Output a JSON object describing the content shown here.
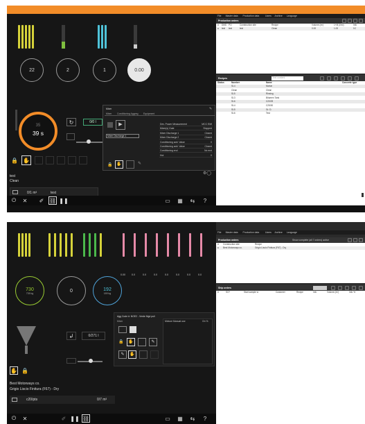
{
  "accent": "#f28c28",
  "top": {
    "menu": [
      "File",
      "Master data",
      "Production data",
      "Users",
      "Archive",
      "Language"
    ],
    "production_orders": {
      "title": "Production orders",
      "columns": [
        "#",
        "DMD",
        "PO",
        "Construction site",
        "Recipe",
        "Volume (m³)",
        "1+M (l/m³)",
        "Info"
      ],
      "row": [
        "",
        "test",
        "test",
        "test",
        "Clean",
        "0.00",
        "1.00",
        "0.0"
      ]
    },
    "mixer": {
      "big_value": "39 s",
      "big_small": "35",
      "circles": [
        "22",
        "2",
        "1",
        "0.00"
      ],
      "counter": "0/0 l",
      "order_name": "test",
      "order_recipe": "Clean",
      "volume": "0/1 m³",
      "volume_name": "test"
    },
    "mixer_dialog": {
      "title": "Mixer",
      "tabs": [
        "Mixer",
        "Conditioning Aggreg",
        "Equipment"
      ],
      "select": "Mixer Discharge 1",
      "rows": [
        {
          "k": "Dev. Power Measurement",
          "v": "MCC EMI"
        },
        {
          "k": "Mixer(s) Gate",
          "v": "Stopped"
        },
        {
          "k": "Mixer Discharge 1",
          "v": "Closed"
        },
        {
          "k": "Mixer Discharge 2",
          "v": "Closed"
        },
        {
          "k": "Conditioning add. Value",
          "v": "0"
        },
        {
          "k": "Conditioning add. Value",
          "v": "Closed"
        },
        {
          "k": "Conditioning end",
          "v": "No end"
        },
        {
          "k": "Hot",
          "v": "0"
        }
      ]
    },
    "recipes": {
      "title": "Recipes",
      "search_placeholder": "Text content",
      "columns": [
        "Status",
        "Number",
        "Name",
        "Concrete type"
      ],
      "rows": [
        {
          "n": "SL4",
          "name": "Mortar"
        },
        {
          "n": "Clean",
          "name": "Clean"
        },
        {
          "n": "SL5",
          "name": "Rinsing"
        },
        {
          "n": "SL3",
          "name": "Bitumen Tank"
        },
        {
          "n": "SL6",
          "name": "C20/25"
        },
        {
          "n": "SL4",
          "name": "C25/30"
        },
        {
          "n": "SL5",
          "name": "Gr. D."
        },
        {
          "n": "SL6",
          "name": "Test"
        }
      ]
    }
  },
  "bottom": {
    "menu": [
      "File",
      "Master data",
      "Production data",
      "Users",
      "Archive",
      "Language"
    ],
    "production_orders": {
      "title": "Production orders",
      "filter_label": "Show complete (all 7 orders) active",
      "columns": [
        "#",
        "Construction site",
        "Recipe"
      ],
      "row": [
        "",
        "Best Motorways co.",
        "Grigio Liscio Finitura (F67) - Dry"
      ]
    },
    "gauges": [
      {
        "value": "730",
        "sub": "735 kg"
      },
      {
        "value": "0",
        "sub": ""
      },
      {
        "value": "192",
        "sub": "189 kg"
      }
    ],
    "additive_readouts": [
      "0.00",
      "0.0",
      "0.0",
      "0.0",
      "0.0",
      "0.0",
      "0.0",
      "0.0"
    ],
    "counter": "0/271 l",
    "recipe_dialog": {
      "title": "Agg Code #:  NGE2 - Verde Mgri puli",
      "subtitle": "Mixer",
      "table_header": [
        "Mixture Manual use",
        "On %"
      ]
    },
    "order_name": "Best Motorways co.",
    "order_recipe": "Grigio Liscio Finitura (F67) - Dry",
    "volume": "0/7 m³",
    "pieces": "c20/pts",
    "ship_orders": {
      "title": "Ship orders",
      "columns": [
        "#",
        "SO*",
        "Start sample w",
        "Customer",
        "Recipe",
        "Info",
        "Volume (m³)",
        "Info %"
      ]
    }
  }
}
